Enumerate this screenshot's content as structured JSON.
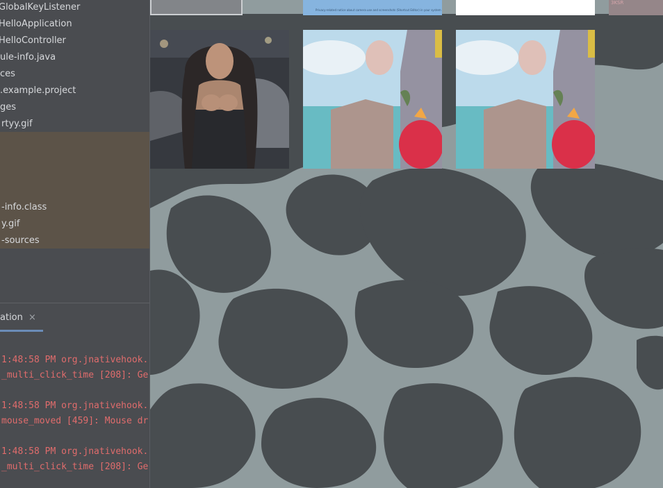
{
  "project_tree": {
    "items": [
      {
        "label": "GlobalKeyListener"
      },
      {
        "label": "HelloApplication"
      },
      {
        "label": "HelloController"
      },
      {
        "label": "ule-info.java"
      },
      {
        "label": "ces"
      },
      {
        "label": ".example.project"
      },
      {
        "label": "ges"
      },
      {
        "label": "rtyy.gif"
      },
      {
        "label": "-info.class"
      },
      {
        "label": "y.gif"
      },
      {
        "label": "-sources"
      }
    ]
  },
  "run_panel": {
    "tab_label": "ation",
    "close_glyph": "×"
  },
  "console": {
    "lines": [
      "1:48:58 PM org.jnativehook.",
      "_multi_click_time [208]: Ge",
      "1:48:58 PM org.jnativehook.",
      "mouse_moved [459]: Mouse dr",
      "1:48:58 PM org.jnativehook.",
      "_multi_click_time [208]: Ge"
    ]
  },
  "gallery": {
    "thumbnails": [
      {
        "subject": "woman-portrait"
      },
      {
        "subject": "sea-fortress-game-scene"
      },
      {
        "subject": "sea-fortress-game-scene"
      }
    ],
    "top_strip_caption": "Privacy-related notice about camera use and screenshots (Shortcut Editor) in your system",
    "corner_label": "3KSR"
  },
  "colors": {
    "console_error": "#e06c6c",
    "tree_text": "#d7d9dc",
    "camo_dark": "#3d4246",
    "camo_light": "#8a9698"
  }
}
